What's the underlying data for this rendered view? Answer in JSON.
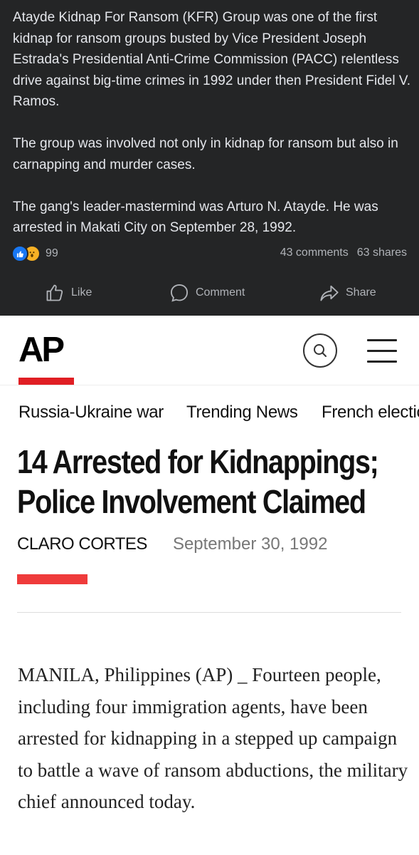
{
  "facebook_post": {
    "paragraphs": [
      "Atayde Kidnap For Ransom (KFR) Group was one of the first kidnap for ransom groups busted by Vice President Joseph Estrada's Presidential Anti-Crime Commission (PACC) relentless drive against big-time crimes in 1992 under then President Fidel V. Ramos.",
      "The group was involved not only in kidnap for ransom but also in carnapping and murder cases.",
      "The gang's leader-mastermind was Arturo N. Atayde. He was arrested in Makati City on September 28, 1992."
    ],
    "reaction_count": "99",
    "comments": "43 comments",
    "shares": "63 shares",
    "actions": {
      "like": "Like",
      "comment": "Comment",
      "share": "Share"
    },
    "colors": {
      "background": "#242526",
      "text": "#e4e6eb",
      "muted": "#b0b3b8"
    }
  },
  "ap": {
    "logo": "AP",
    "nav": [
      "Russia-Ukraine war",
      "Trending News",
      "French election"
    ],
    "headline_line1": "14 Arrested for Kidnappings;",
    "headline_line2": "Police Involvement Claimed",
    "author": "CLARO CORTES",
    "date": "September 30, 1992",
    "body": "MANILA, Philippines (AP) _ Fourteen people, including four immigration agents, have been arrested for kidnapping in a stepped up campaign to battle a wave of ransom abductions, the military chief announced today.",
    "colors": {
      "accent": "#e01e24",
      "bar": "#ef3b3b"
    }
  }
}
